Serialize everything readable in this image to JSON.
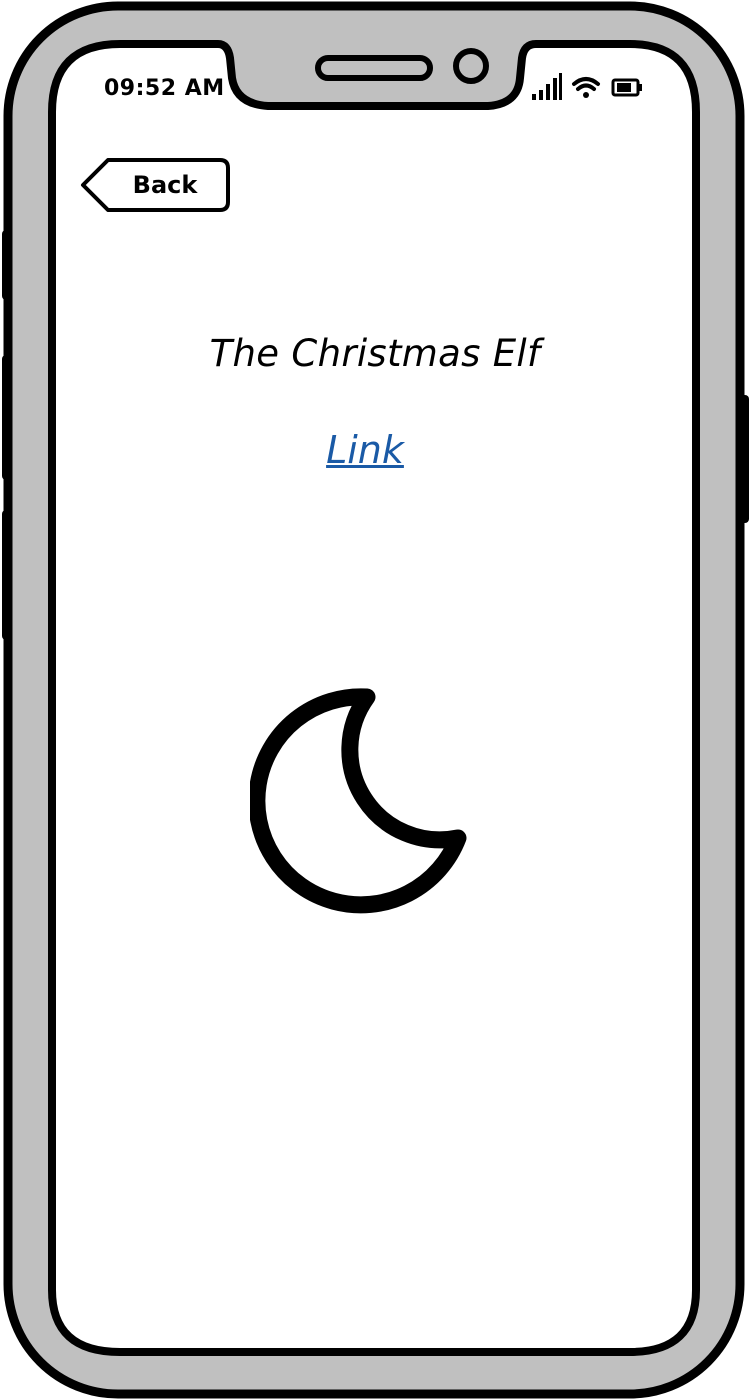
{
  "status_bar": {
    "time": "09:52 AM",
    "icons": [
      "signal-icon",
      "wifi-icon",
      "battery-icon"
    ]
  },
  "nav": {
    "back_label": "Back"
  },
  "content": {
    "title": "The Christmas Elf",
    "link_label": "Link",
    "image_icon": "moon-icon"
  },
  "colors": {
    "frame": "#c0c0c0",
    "outline": "#000000",
    "screen": "#ffffff",
    "link": "#1a5aa6"
  }
}
